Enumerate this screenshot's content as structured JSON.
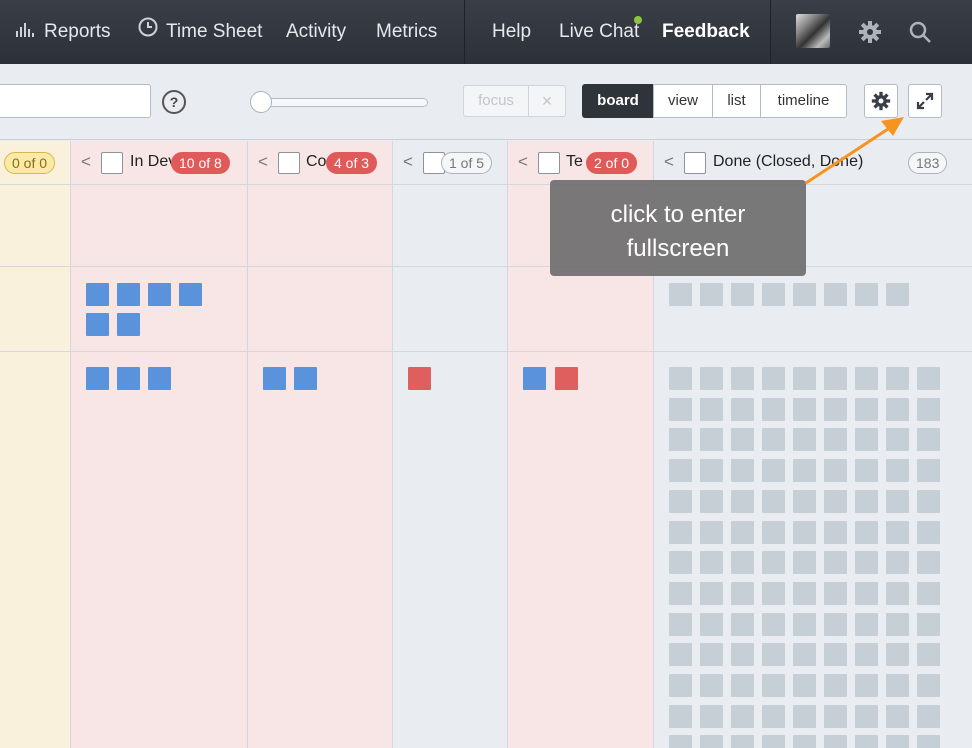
{
  "nav": {
    "reports": "Reports",
    "time_sheet": "Time Sheet",
    "activity": "Activity",
    "metrics": "Metrics",
    "help": "Help",
    "live_chat": "Live Chat",
    "feedback": "Feedback"
  },
  "toolbar": {
    "search_value": "",
    "help_label": "?",
    "focus_label": "focus",
    "clear_label": "×",
    "views": [
      "board",
      "view",
      "list",
      "timeline"
    ],
    "active_view": "board"
  },
  "columns": [
    {
      "title": "",
      "badge": "0 of 0",
      "badge_style": "yellow"
    },
    {
      "title": "In Dev",
      "badge": "10 of 8",
      "badge_style": "red"
    },
    {
      "title": "Co",
      "badge": "4 of 3",
      "badge_style": "red"
    },
    {
      "title": "",
      "badge": "1 of 5",
      "badge_style": "gray"
    },
    {
      "title": "Te",
      "badge": "2 of 0",
      "badge_style": "red"
    },
    {
      "title": "Done (Closed, Done)",
      "badge": "183",
      "badge_style": "gray"
    }
  ],
  "tooltip": {
    "line1": "click to enter",
    "line2": "fullscreen"
  },
  "colors": {
    "accent_arrow": "#f7941d",
    "wip_over": "#e05a5a",
    "card_blue": "#5a93dc",
    "card_red": "#df5f5f",
    "card_done": "#c6ced6"
  }
}
